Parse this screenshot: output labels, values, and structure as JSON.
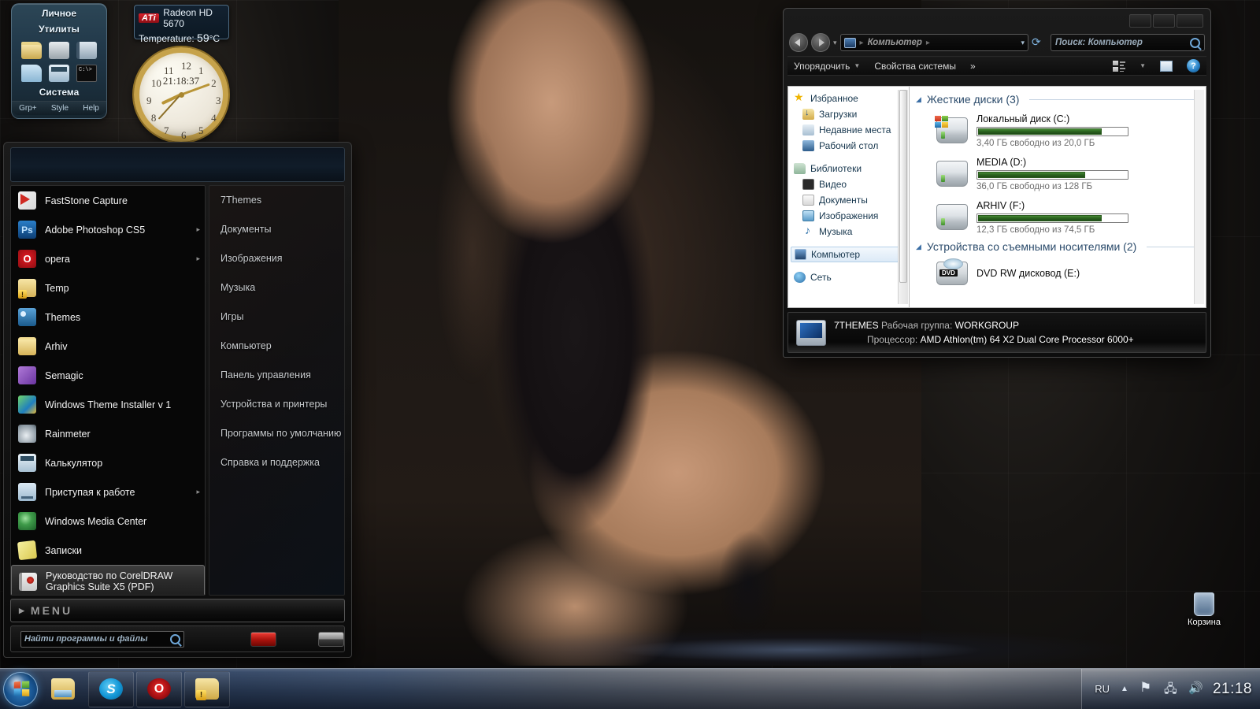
{
  "gadgets": {
    "sysbar": {
      "title_line1": "Личное",
      "title_line2": "Утилиты",
      "system_label": "Система",
      "footer": [
        "Grp+",
        "Style",
        "Help"
      ],
      "icons": [
        "folder-icon",
        "drive-icon",
        "book-icon",
        "page-icon",
        "calculator-icon",
        "command-prompt-icon"
      ]
    },
    "gpu": {
      "brand": "ATi",
      "model": "Radeon HD 5670",
      "temp_label": "Temperature:",
      "temp_value": "59",
      "temp_unit": "°C"
    },
    "clock": {
      "digital_time": "21:18:37",
      "numerals": [
        "12",
        "1",
        "2",
        "3",
        "4",
        "5",
        "6",
        "7",
        "8",
        "9",
        "10",
        "11"
      ]
    }
  },
  "desktop": {
    "recycle_bin_label": "Корзина"
  },
  "start_menu": {
    "programs": [
      {
        "label": "FastStone Capture",
        "icon": "faststone-capture-icon",
        "icon_class": "ico-fscapture",
        "arrow": ""
      },
      {
        "label": "Adobe Photoshop CS5",
        "icon": "photoshop-icon",
        "icon_class": "ico-ps",
        "icon_text": "Ps",
        "arrow": "▸"
      },
      {
        "label": "opera",
        "icon": "opera-icon",
        "icon_class": "ico-opera",
        "icon_text": "O",
        "arrow": "▸"
      },
      {
        "label": "Temp",
        "icon": "folder-warning-icon",
        "icon_class": "ico-warnfolder",
        "arrow": ""
      },
      {
        "label": "Themes",
        "icon": "themes-icon",
        "icon_class": "ico-themes",
        "arrow": ""
      },
      {
        "label": "Arhiv",
        "icon": "folder-icon",
        "icon_class": "ico-folder",
        "arrow": ""
      },
      {
        "label": "Semagic",
        "icon": "semagic-icon",
        "icon_class": "ico-semagic",
        "arrow": ""
      },
      {
        "label": "Windows Theme Installer v 1",
        "icon": "theme-installer-icon",
        "icon_class": "ico-wti",
        "arrow": ""
      },
      {
        "label": "Rainmeter",
        "icon": "rainmeter-icon",
        "icon_class": "ico-rain",
        "arrow": ""
      },
      {
        "label": "Калькулятор",
        "icon": "calculator-icon",
        "icon_class": "ico-calc",
        "arrow": ""
      },
      {
        "label": "Приступая к работе",
        "icon": "getting-started-icon",
        "icon_class": "ico-start",
        "arrow": "▸"
      },
      {
        "label": "Windows Media Center",
        "icon": "media-center-icon",
        "icon_class": "ico-wmc",
        "arrow": ""
      },
      {
        "label": "Записки",
        "icon": "sticky-notes-icon",
        "icon_class": "ico-notes",
        "arrow": ""
      },
      {
        "label": "Руководство по CorelDRAW Graphics Suite X5 (PDF)",
        "icon": "pdf-icon",
        "icon_class": "ico-pdf",
        "arrow": "",
        "selected": true
      }
    ],
    "places": [
      "7Themes",
      "Документы",
      "Изображения",
      "Музыка",
      "Игры",
      "Компьютер",
      "Панель управления",
      "Устройства и принтеры",
      "Программы по умолчанию",
      "Справка и поддержка"
    ],
    "all_programs_label": "MENU",
    "search_placeholder": "Найти программы и файлы"
  },
  "explorer": {
    "address": {
      "root": "Компьютер",
      "search_placeholder": "Поиск: Компьютер"
    },
    "toolbar": {
      "organize": "Упорядочить",
      "system_properties": "Свойства системы",
      "more": "»",
      "help_glyph": "?"
    },
    "nav_tree": [
      {
        "label": "Избранное",
        "icon": "favorites-star-icon",
        "icon_class": "nv-star",
        "level": 0
      },
      {
        "label": "Загрузки",
        "icon": "downloads-icon",
        "icon_class": "nv-dl",
        "level": 1
      },
      {
        "label": "Недавние места",
        "icon": "recent-places-icon",
        "icon_class": "nv-recent",
        "level": 1
      },
      {
        "label": "Рабочий стол",
        "icon": "desktop-icon",
        "icon_class": "nv-desk",
        "level": 1
      },
      {
        "label": "",
        "icon": "spacer",
        "icon_class": "",
        "level": 0,
        "spacer": true
      },
      {
        "label": "Библиотеки",
        "icon": "libraries-icon",
        "icon_class": "nv-lib",
        "level": 0
      },
      {
        "label": "Видео",
        "icon": "video-library-icon",
        "icon_class": "nv-video",
        "level": 1
      },
      {
        "label": "Документы",
        "icon": "documents-library-icon",
        "icon_class": "nv-doc",
        "level": 1
      },
      {
        "label": "Изображения",
        "icon": "pictures-library-icon",
        "icon_class": "nv-pic",
        "level": 1
      },
      {
        "label": "Музыка",
        "icon": "music-library-icon",
        "icon_class": "nv-music",
        "level": 1
      },
      {
        "label": "",
        "icon": "spacer",
        "icon_class": "",
        "level": 0,
        "spacer": true
      },
      {
        "label": "Компьютер",
        "icon": "computer-icon",
        "icon_class": "nv-pc",
        "level": 0,
        "selected": true
      },
      {
        "label": "",
        "icon": "spacer",
        "icon_class": "",
        "level": 0,
        "spacer": true
      },
      {
        "label": "Сеть",
        "icon": "network-icon",
        "icon_class": "nv-net",
        "level": 0
      }
    ],
    "groups": [
      {
        "title": "Жесткие диски (3)",
        "type": "drives",
        "items": [
          {
            "name": "Локальный диск (C:)",
            "free_text": "3,40 ГБ свободно из 20,0 ГБ",
            "used_pct": 83,
            "system": true
          },
          {
            "name": "MEDIA (D:)",
            "free_text": "36,0 ГБ свободно из 128 ГБ",
            "used_pct": 72,
            "system": false
          },
          {
            "name": "ARHIV (F:)",
            "free_text": "12,3 ГБ свободно из 74,5 ГБ",
            "used_pct": 83,
            "system": false
          }
        ]
      },
      {
        "title": "Устройства со съемными носителями (2)",
        "type": "devices",
        "items": [
          {
            "name": "DVD RW дисковод (E:)"
          }
        ]
      }
    ],
    "status": {
      "computer_name": "7THEMES",
      "workgroup_label": "Рабочая группа:",
      "workgroup_value": "WORKGROUP",
      "cpu_label": "Процессор:",
      "cpu_value": "AMD Athlon(tm) 64 X2 Dual Core Processor 6000+"
    }
  },
  "taskbar": {
    "start_label": "Пуск",
    "buttons": [
      {
        "name": "explorer",
        "icon": "windows-explorer-icon",
        "icon_class": "tbi-explorer",
        "icon_text": "",
        "pinned_plain": true
      },
      {
        "name": "skype",
        "icon": "skype-icon",
        "icon_class": "tbi-skype",
        "icon_text": "S",
        "pinned_plain": false
      },
      {
        "name": "opera",
        "icon": "opera-icon",
        "icon_class": "tbi-opera",
        "icon_text": "O",
        "pinned_plain": false
      },
      {
        "name": "temp-folder",
        "icon": "folder-warning-icon",
        "icon_class": "tbi-warnfolder",
        "icon_text": "",
        "pinned_plain": false
      }
    ],
    "tray": {
      "language": "RU",
      "show_hidden_caret": "▲",
      "icons": [
        "action-center-flag-icon",
        "network-icon",
        "volume-icon"
      ],
      "clock": "21:18"
    }
  }
}
